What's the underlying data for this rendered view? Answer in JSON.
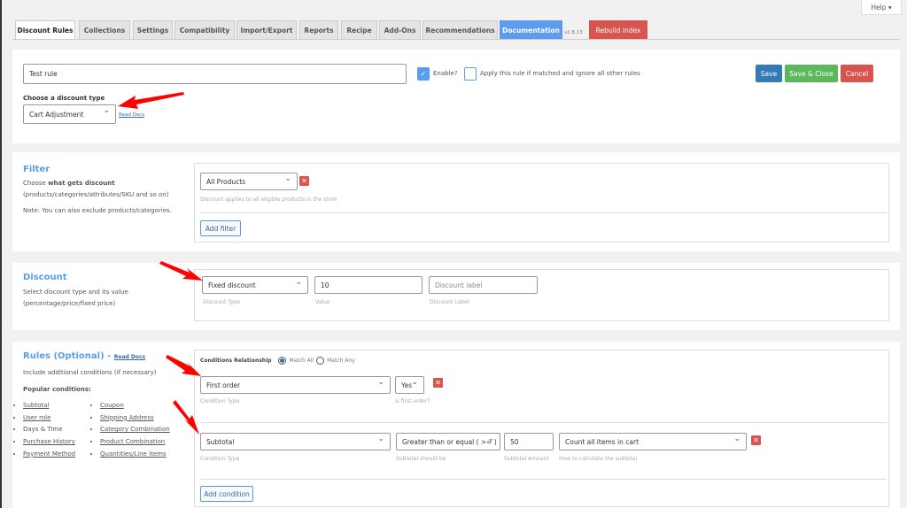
{
  "help_label": "Help ▾",
  "tabs": [
    {
      "label": "Discount Rules",
      "active": true
    },
    {
      "label": "Collections"
    },
    {
      "label": "Settings"
    },
    {
      "label": "Compatibility"
    },
    {
      "label": "Import/Export"
    },
    {
      "label": "Reports"
    },
    {
      "label": "Recipe"
    },
    {
      "label": "Add-Ons"
    },
    {
      "label": "Recommendations"
    },
    {
      "label": "Documentation"
    }
  ],
  "version": "v2.8.13",
  "rebuild_index": "Rebuild index",
  "header": {
    "rule_name": "Test rule",
    "enable_label": "Enable?",
    "enable_checked": true,
    "exclusive_label": "Apply this rule if matched and ignore all other rules",
    "exclusive_checked": false,
    "save": "Save",
    "save_close": "Save & Close",
    "cancel": "Cancel",
    "discount_type_label": "Choose a discount type",
    "discount_type_value": "Cart Adjustment",
    "read_docs": "Read Docs"
  },
  "filter": {
    "title": "Filter",
    "desc_prefix": "Choose ",
    "desc_bold": "what gets discount",
    "desc_line2": "(products/categories/attributes/SKU and so on)",
    "note": "Note: You can also exclude products/categories.",
    "select_value": "All Products",
    "hint": "Discount applies to all eligible products in the store",
    "add_filter": "Add filter"
  },
  "discount": {
    "title": "Discount",
    "desc1": "Select discount type and its value",
    "desc2": "(percentage/price/fixed price)",
    "type_value": "Fixed discount",
    "type_label": "Discount Type",
    "value": "10",
    "value_label": "Value",
    "label_placeholder": "Discount label",
    "label_label": "Discount Label"
  },
  "rules": {
    "title": "Rules (Optional) -",
    "read_docs": "Read Docs",
    "desc": "Include additional conditions (if necessary)",
    "popular": "Popular conditions:",
    "col1": [
      "Subtotal",
      "User role",
      "Days & Time",
      "Purchase History",
      "Payment Method"
    ],
    "col2": [
      "Coupon",
      "Shipping Address",
      "Category Combination",
      "Product Combination",
      "Quantities/Line items"
    ],
    "relationship_label": "Conditions Relationship",
    "match_all": "Match All",
    "match_any": "Match Any",
    "selected": "Match All",
    "condition1": {
      "type": "First order",
      "type_label": "Condition Type",
      "value": "Yes",
      "value_label": "is first order?"
    },
    "condition2": {
      "type": "Subtotal",
      "type_label": "Condition Type",
      "operator": "Greater than or equal ( >= )",
      "operator_label": "Subtotal should be",
      "amount": "50",
      "amount_label": "Subtotal Amount",
      "calc": "Count all items in cart",
      "calc_label": "How to calculate the subtotal"
    },
    "add_condition": "Add condition"
  },
  "colors": {
    "accent": "#5b9bf0",
    "save": "#337ab7",
    "save_close": "#5cb85c",
    "cancel": "#d9534f",
    "arrow": "#ff0000"
  }
}
